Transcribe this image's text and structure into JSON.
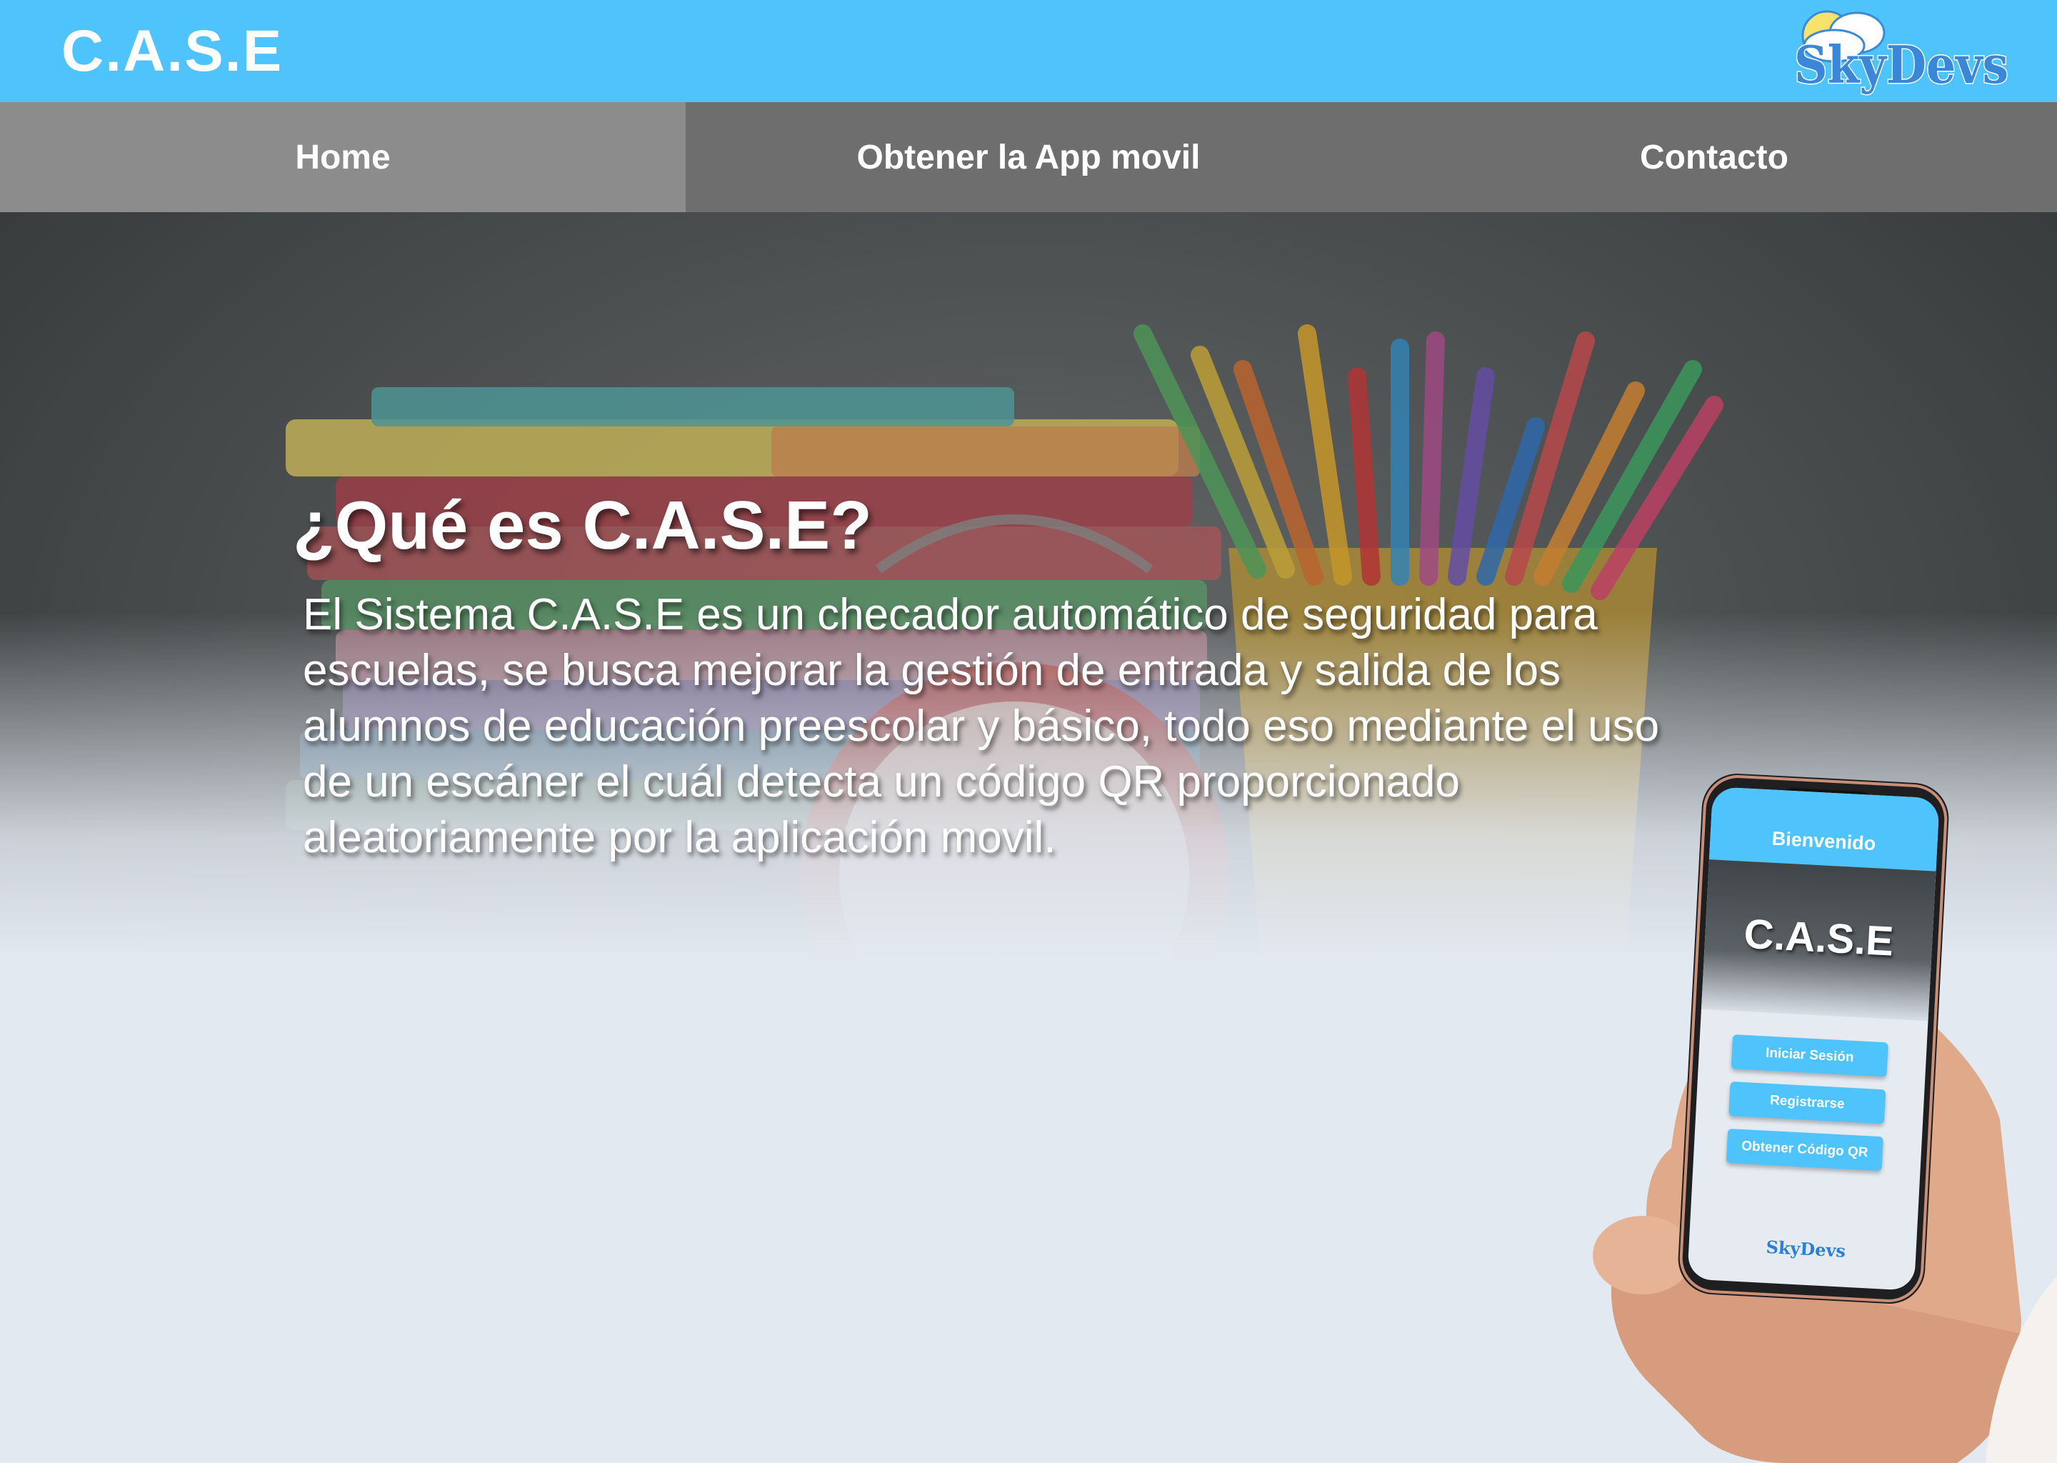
{
  "header": {
    "title": "C.A.S.E",
    "logo_text": "SkyDevs",
    "accent_color": "#4fc3fb"
  },
  "nav": {
    "items": [
      {
        "label": "Home",
        "active": true
      },
      {
        "label": "Obtener la App movil",
        "active": false
      },
      {
        "label": "Contacto",
        "active": false
      }
    ]
  },
  "hero": {
    "title": "¿Qué es C.A.S.E?",
    "description": "El Sistema C.A.S.E es un checador automático de seguridad para escuelas, se busca mejorar la gestión de entrada y salida de los alumnos de educación preescolar y básico, todo eso mediante el uso de un escáner el cuál detecta un código QR proporcionado aleatoriamente por la aplicación movil.",
    "background_icons": [
      "books-image",
      "pencils-image",
      "alarm-clock-image"
    ]
  },
  "phone_mockup": {
    "header": "Bienvenido",
    "brand": "C.A.S.E",
    "buttons": [
      "Iniciar Sesión",
      "Registrarse",
      "Obtener Código QR"
    ],
    "logo_text": "SkyDevs"
  }
}
